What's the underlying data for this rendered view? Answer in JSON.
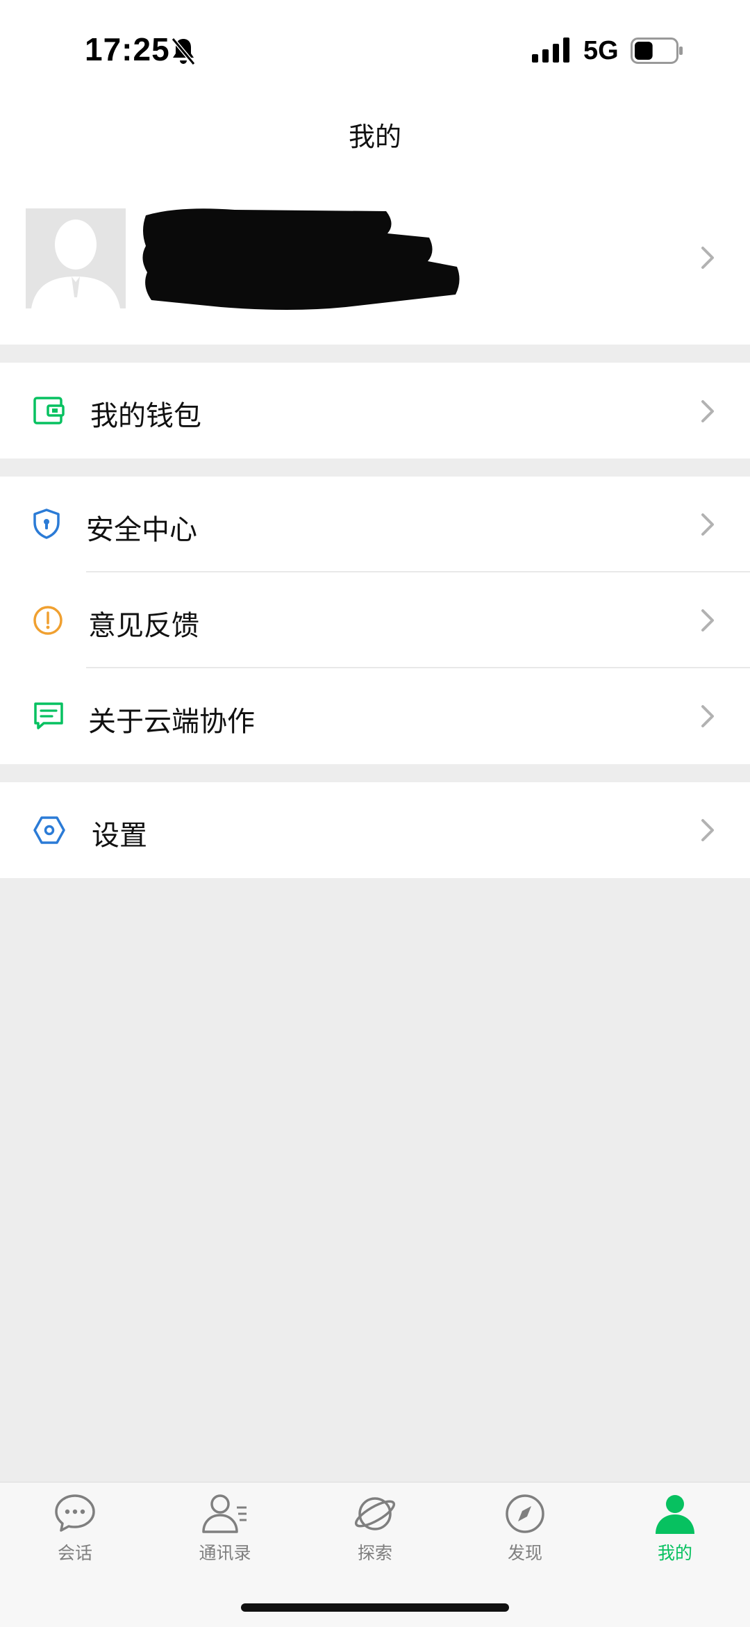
{
  "status_bar": {
    "time": "17:25",
    "network": "5G",
    "battery_percent": 45
  },
  "header": {
    "title": "我的"
  },
  "profile": {
    "name_redacted": true
  },
  "menu": {
    "wallet": {
      "label": "我的钱包"
    },
    "security": {
      "label": "安全中心"
    },
    "feedback": {
      "label": "意见反馈"
    },
    "about": {
      "label": "关于云端协作"
    },
    "settings": {
      "label": "设置"
    }
  },
  "tabbar": {
    "items": [
      {
        "label": "会话",
        "icon": "chat-bubble-icon",
        "active": false
      },
      {
        "label": "通讯录",
        "icon": "contacts-icon",
        "active": false
      },
      {
        "label": "探索",
        "icon": "planet-icon",
        "active": false
      },
      {
        "label": "发现",
        "icon": "compass-icon",
        "active": false
      },
      {
        "label": "我的",
        "icon": "person-icon",
        "active": true
      }
    ]
  },
  "colors": {
    "accent_green": "#07c160",
    "security_blue": "#2b7bd6",
    "feedback_orange": "#f0a030",
    "background_gray": "#ededed"
  }
}
